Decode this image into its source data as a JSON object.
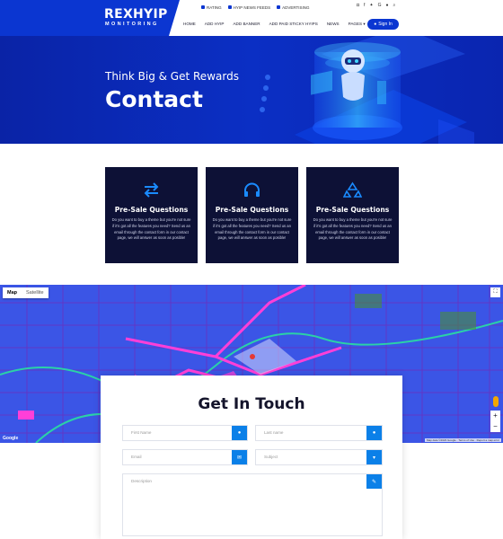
{
  "brand": {
    "title": "REXHYIP",
    "subtitle": "MONITORING",
    "color": "#0b36d1"
  },
  "topbar": {
    "items": [
      "RATING",
      "HYIP NEWS FEEDS",
      "ADVERTISING"
    ]
  },
  "socials": [
    "instagram-icon",
    "facebook-icon",
    "twitter-icon",
    "google-icon",
    "user-icon",
    "search-icon"
  ],
  "nav": {
    "items": [
      "HOME",
      "ADD HYIP",
      "ADD BANNER",
      "ADD PAID STICKY HYIPS",
      "NEWS",
      "PAGES ▾"
    ],
    "signin": "Sign In"
  },
  "hero": {
    "subtitle": "Think Big & Get Rewards",
    "title": "Contact"
  },
  "cards": [
    {
      "icon": "arrows-swap-icon",
      "title": "Pre-Sale Questions",
      "text": "Do you want to buy a theme but you're not sure if it's got all the features you need? Send us an email through the contact form in our contact page, we will answer as soon as posible!"
    },
    {
      "icon": "headphones-icon",
      "title": "Pre-Sale Questions",
      "text": "Do you want to buy a theme but you're not sure if it's got all the features you need? Send us an email through the contact form in our contact page, we will answer as soon as posible!"
    },
    {
      "icon": "recycle-icon",
      "title": "Pre-Sale Questions",
      "text": "Do you want to buy a theme but you're not sure if it's got all the features you need? Send us an email through the contact form in our contact page, we will answer as soon as posible!"
    }
  ],
  "map": {
    "tabs": [
      "Map",
      "Satellite"
    ],
    "attribution": "Map data ©2023 Google · Terms of Use · Report a map error",
    "google": "Google",
    "zoom_in": "+",
    "zoom_out": "−"
  },
  "form": {
    "title": "Get In Touch",
    "first_name": "First Name",
    "last_name": "Last name",
    "email": "Email",
    "subject": "Subject",
    "description": "Description"
  }
}
